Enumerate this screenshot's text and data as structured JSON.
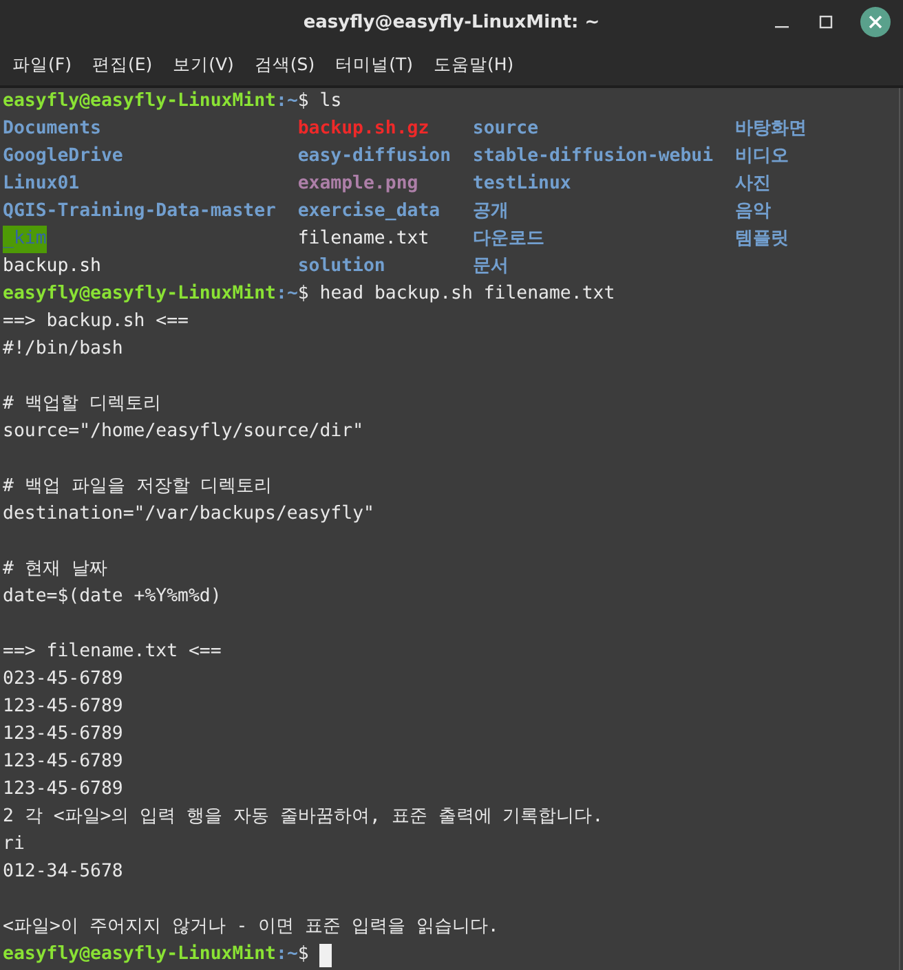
{
  "window": {
    "title": "easyfly@easyfly-LinuxMint: ~"
  },
  "menu": [
    "파일(F)",
    "편집(E)",
    "보기(V)",
    "검색(S)",
    "터미널(T)",
    "도움말(H)"
  ],
  "terminal": {
    "lines": [
      {
        "kind": "prompt",
        "user_host": "easyfly@easyfly-LinuxMint",
        "separator": ":",
        "path": "~",
        "symbol": "$",
        "command": "ls"
      },
      {
        "kind": "ls",
        "entries": [
          {
            "name": "Documents",
            "kind": "dir"
          },
          {
            "name": "backup.sh.gz",
            "kind": "archive"
          },
          {
            "name": "source",
            "kind": "dir"
          },
          {
            "name": "바탕화면",
            "kind": "dir"
          }
        ]
      },
      {
        "kind": "ls",
        "entries": [
          {
            "name": "GoogleDrive",
            "kind": "dir"
          },
          {
            "name": "easy-diffusion",
            "kind": "dir"
          },
          {
            "name": "stable-diffusion-webui",
            "kind": "dir"
          },
          {
            "name": "비디오",
            "kind": "dir"
          }
        ]
      },
      {
        "kind": "ls",
        "entries": [
          {
            "name": "Linux01",
            "kind": "dir"
          },
          {
            "name": "example.png",
            "kind": "image"
          },
          {
            "name": "testLinux",
            "kind": "dir"
          },
          {
            "name": "사진",
            "kind": "dir"
          }
        ]
      },
      {
        "kind": "ls",
        "entries": [
          {
            "name": "QGIS-Training-Data-master",
            "kind": "dir"
          },
          {
            "name": "exercise_data",
            "kind": "dir"
          },
          {
            "name": "공개",
            "kind": "dir"
          },
          {
            "name": "음악",
            "kind": "dir"
          }
        ]
      },
      {
        "kind": "ls",
        "entries": [
          {
            "name": "_kim",
            "kind": "writable-dir"
          },
          {
            "name": "filename.txt",
            "kind": "file"
          },
          {
            "name": "다운로드",
            "kind": "dir"
          },
          {
            "name": "템플릿",
            "kind": "dir"
          }
        ]
      },
      {
        "kind": "ls",
        "entries": [
          {
            "name": "backup.sh",
            "kind": "file"
          },
          {
            "name": "solution",
            "kind": "dir"
          },
          {
            "name": "문서",
            "kind": "dir"
          }
        ]
      },
      {
        "kind": "prompt",
        "user_host": "easyfly@easyfly-LinuxMint",
        "separator": ":",
        "path": "~",
        "symbol": "$",
        "command": "head backup.sh filename.txt"
      },
      {
        "kind": "text",
        "text": "==> backup.sh <=="
      },
      {
        "kind": "text",
        "text": "#!/bin/bash"
      },
      {
        "kind": "blank"
      },
      {
        "kind": "text",
        "text": "# 백업할 디렉토리"
      },
      {
        "kind": "text",
        "text": "source=\"/home/easyfly/source/dir\""
      },
      {
        "kind": "blank"
      },
      {
        "kind": "text",
        "text": "# 백업 파일을 저장할 디렉토리"
      },
      {
        "kind": "text",
        "text": "destination=\"/var/backups/easyfly\""
      },
      {
        "kind": "blank"
      },
      {
        "kind": "text",
        "text": "# 현재 날짜"
      },
      {
        "kind": "text",
        "text": "date=$(date +%Y%m%d)"
      },
      {
        "kind": "blank"
      },
      {
        "kind": "text",
        "text": "==> filename.txt <=="
      },
      {
        "kind": "text",
        "text": "023-45-6789"
      },
      {
        "kind": "text",
        "text": "123-45-6789"
      },
      {
        "kind": "text",
        "text": "123-45-6789"
      },
      {
        "kind": "text",
        "text": "123-45-6789"
      },
      {
        "kind": "text",
        "text": "123-45-6789"
      },
      {
        "kind": "text",
        "text": "2 각 <파일>의 입력 행을 자동 줄바꿈하여, 표준 출력에 기록합니다."
      },
      {
        "kind": "text",
        "text": "ri"
      },
      {
        "kind": "text",
        "text": "012-34-5678"
      },
      {
        "kind": "blank"
      },
      {
        "kind": "text",
        "text": "<파일>이 주어지지 않거나 - 이면 표준 입력을 읽습니다."
      },
      {
        "kind": "prompt",
        "user_host": "easyfly@easyfly-LinuxMint",
        "separator": ":",
        "path": "~",
        "symbol": "$",
        "cursor": true
      }
    ]
  }
}
